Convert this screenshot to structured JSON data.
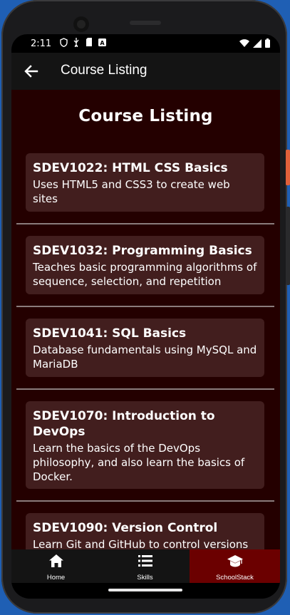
{
  "status": {
    "time": "2:11",
    "notification_icons": [
      "shield-icon",
      "usb-icon",
      "sd-card-icon",
      "a-icon"
    ],
    "system_icons": [
      "wifi-icon",
      "signal-icon",
      "battery-icon"
    ]
  },
  "appbar": {
    "title": "Course Listing",
    "back_icon": "arrow-left-icon"
  },
  "page": {
    "heading": "Course Listing"
  },
  "courses": [
    {
      "title": "SDEV1022: HTML CSS Basics",
      "description": "Uses HTML5 and CSS3 to create web sites"
    },
    {
      "title": "SDEV1032: Programming Basics",
      "description": "Teaches basic programming algorithms of sequence, selection, and repetition"
    },
    {
      "title": "SDEV1041: SQL Basics",
      "description": "Database fundamentals using MySQL and MariaDB"
    },
    {
      "title": "SDEV1070: Introduction to DevOps",
      "description": "Learn the basics of the DevOps philosophy, and also learn the basics of Docker."
    },
    {
      "title": "SDEV1090: Version Control",
      "description": "Learn Git and GitHub to control versions"
    }
  ],
  "bottom_nav": {
    "items": [
      {
        "label": "Home",
        "icon": "home-icon",
        "active": false
      },
      {
        "label": "Skills",
        "icon": "list-icon",
        "active": false
      },
      {
        "label": "SchoolStack",
        "icon": "graduation-cap-icon",
        "active": true
      }
    ]
  },
  "colors": {
    "content_bg": "#240000",
    "card_bg": "#421e1e",
    "active_nav": "#6b0000",
    "appbar_bg": "#141414"
  }
}
